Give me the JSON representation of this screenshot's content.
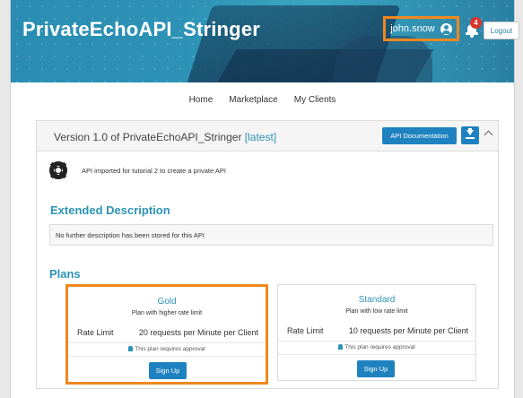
{
  "header": {
    "site_title": "PrivateEchoAPI_Stringer",
    "username": "john.snow",
    "notification_count": "4",
    "logout_label": "Logout"
  },
  "nav": {
    "items": [
      "Home",
      "Marketplace",
      "My Clients"
    ]
  },
  "api": {
    "version_prefix": "Version 1.0 of PrivateEchoAPI_Stringer",
    "latest_tag": "[latest]",
    "doc_button": "API Documentation",
    "summary": "API imported for tutorial 2 to create a private API"
  },
  "extended": {
    "heading": "Extended Description",
    "text": "No further description has been stored for this API"
  },
  "plans": {
    "heading": "Plans",
    "items": [
      {
        "name": "Gold",
        "description": "Plan with higher rate limit",
        "rate_label": "Rate Limit",
        "rate_value": "20 requests per Minute per Client",
        "approval": "This plan requires approval",
        "signup": "Sign Up"
      },
      {
        "name": "Standard",
        "description": "Plan with low rate limit",
        "rate_label": "Rate Limit",
        "rate_value": "10 requests per Minute per Client",
        "approval": "This plan requires approval",
        "signup": "Sign Up"
      }
    ]
  },
  "colors": {
    "accent": "#2d93b6",
    "button": "#1f82c0",
    "highlight": "#f0881e",
    "badge": "#d9342b"
  }
}
